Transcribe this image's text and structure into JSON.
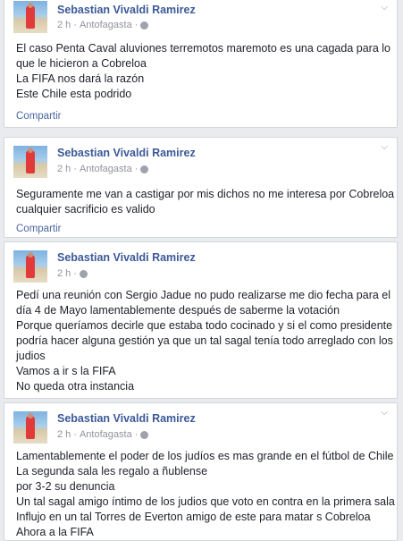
{
  "posts": [
    {
      "author": "Sebastian Vivaldi Ramirez",
      "time": "2 h",
      "location": "Antofagasta",
      "lines": [
        "El caso Penta Caval aluviones terremotos maremoto es una cagada para lo",
        "que le hicieron a Cobreloa",
        "La FIFA nos dará la razón",
        "Este Chile esta podrido"
      ],
      "share_label": "Compartir"
    },
    {
      "author": "Sebastian Vivaldi Ramirez",
      "time": "2 h",
      "location": "Antofagasta",
      "lines": [
        "Seguramente me van a castigar por mis dichos no me interesa por Cobreloa",
        "cualquier sacrificio es valido"
      ],
      "share_label": "Compartir"
    },
    {
      "author": "Sebastian Vivaldi Ramirez",
      "time": "2 h",
      "location": "",
      "lines": [
        "Pedí una reunión con Sergio Jadue no pudo realizarse me dio fecha para el",
        "día 4 de Mayo lamentablemente después de saberme la votación",
        "Porque queríamos decirle que estaba todo cocinado y si el como presidente",
        "podría hacer alguna gestión ya que un tal sagal tenía todo arreglado con los",
        "judios",
        "Vamos a ir s la FIFA",
        "No queda otra instancia"
      ],
      "share_label": ""
    },
    {
      "author": "Sebastian Vivaldi Ramirez",
      "time": "2 h",
      "location": "Antofagasta",
      "lines": [
        "Lamentablemente el poder de los judíos es mas grande en el fútbol de Chile",
        "La segunda sala les regalo a ñublense",
        "por 3-2 su denuncia",
        "Un tal sagal amigo íntimo de los judios que voto en contra en la primera sala",
        "Influjo en un tal Torres de Everton amigo de este para matar s Cobreloa",
        "Ahora a la FIFA"
      ],
      "share_label": ""
    }
  ],
  "separator": "·",
  "colors": {
    "background": "#e9ebee",
    "author": "#3b5998",
    "meta": "#90949c",
    "text": "#1d2129",
    "share": "#4b67a1"
  },
  "icons": {
    "audience": "globe-icon",
    "menu": "chevron-down-icon"
  }
}
